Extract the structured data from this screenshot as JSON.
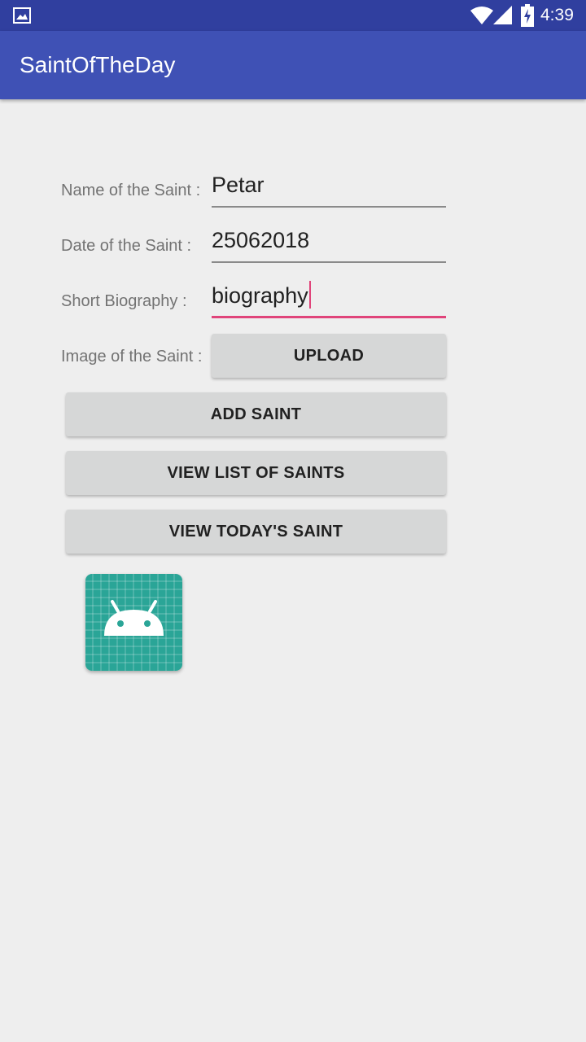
{
  "status_bar": {
    "time": "4:39",
    "icons": [
      "image-notification-icon",
      "wifi-icon",
      "signal-icon",
      "battery-charging-icon"
    ]
  },
  "app_bar": {
    "title": "SaintOfTheDay"
  },
  "form": {
    "name": {
      "label": "Name of the Saint :",
      "value": "Petar"
    },
    "date": {
      "label": "Date of the Saint :",
      "value": "25062018"
    },
    "biography": {
      "label": "Short Biography :",
      "value": "biography"
    },
    "image": {
      "label": "Image of the Saint :",
      "upload_label": "UPLOAD"
    }
  },
  "buttons": {
    "add": "ADD SAINT",
    "view_list": "VIEW LIST OF SAINTS",
    "view_today": "VIEW TODAY'S SAINT"
  },
  "preview": {
    "icon": "android-launcher-icon"
  },
  "colors": {
    "primary": "#3f51b5",
    "primary_dark": "#303f9f",
    "accent": "#e0447a",
    "preview_bg": "#2aa597"
  }
}
